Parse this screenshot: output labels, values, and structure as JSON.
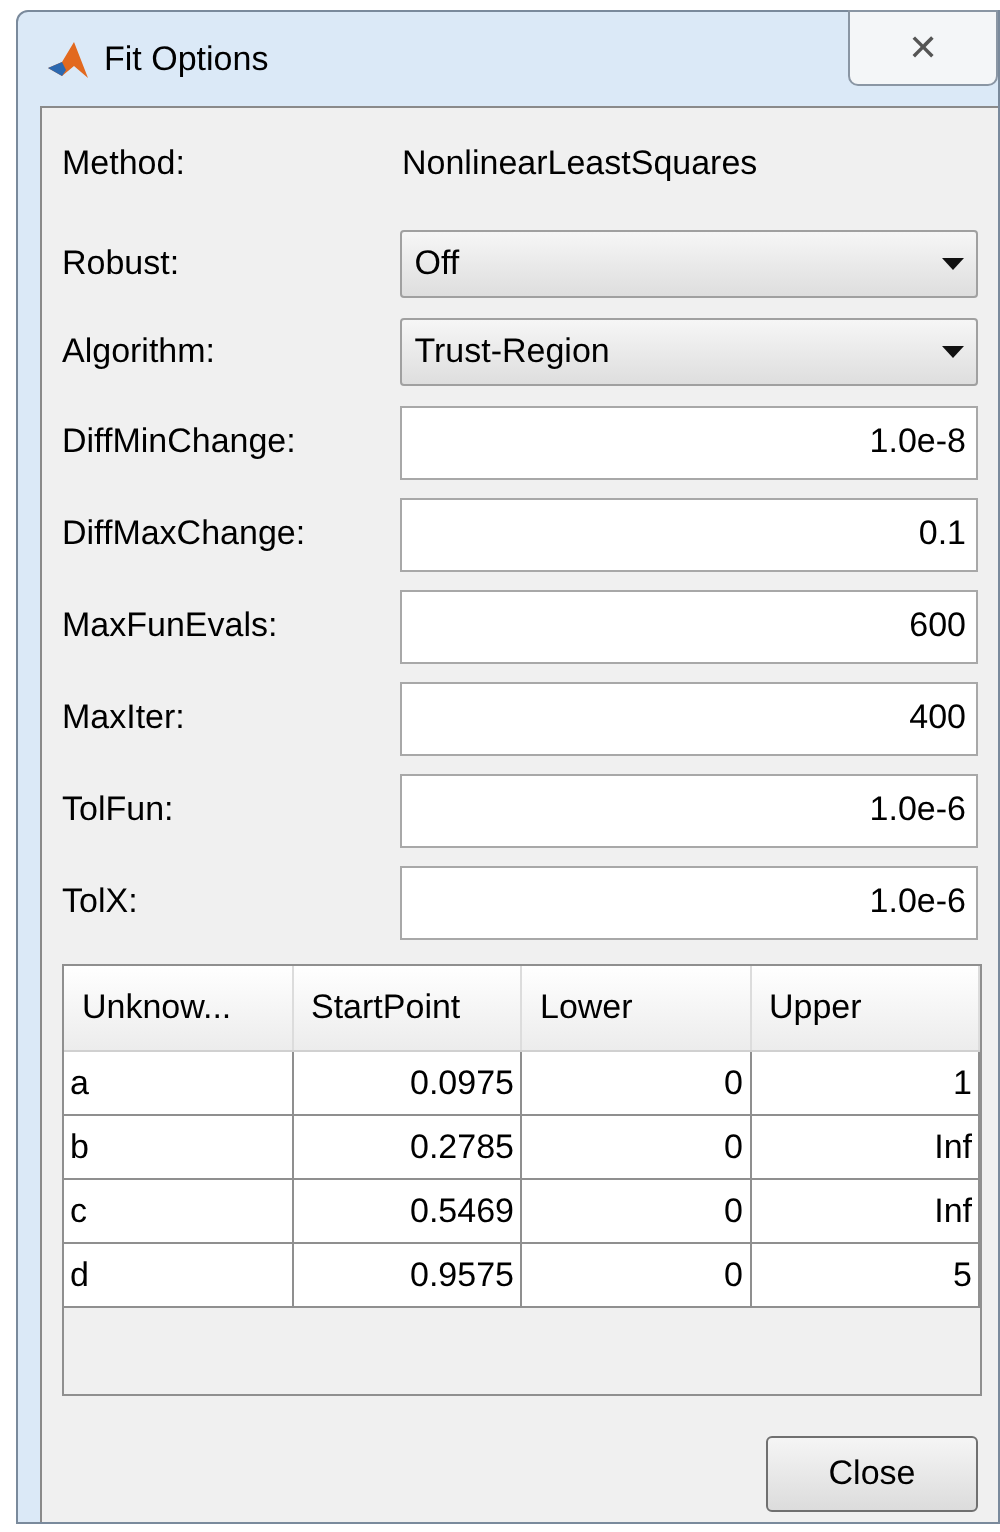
{
  "window": {
    "title": "Fit Options",
    "close": "✕"
  },
  "method": {
    "label": "Method:",
    "value": "NonlinearLeastSquares"
  },
  "options": [
    {
      "kind": "dropdown",
      "label": "Robust:",
      "value": "Off"
    },
    {
      "kind": "dropdown",
      "label": "Algorithm:",
      "value": "Trust-Region"
    },
    {
      "kind": "text",
      "label": "DiffMinChange:",
      "value": "1.0e-8"
    },
    {
      "kind": "text",
      "label": "DiffMaxChange:",
      "value": "0.1"
    },
    {
      "kind": "text",
      "label": "MaxFunEvals:",
      "value": "600"
    },
    {
      "kind": "text",
      "label": "MaxIter:",
      "value": "400"
    },
    {
      "kind": "text",
      "label": "TolFun:",
      "value": "1.0e-6"
    },
    {
      "kind": "text",
      "label": "TolX:",
      "value": "1.0e-6"
    }
  ],
  "table": {
    "columns": [
      "Unknow...",
      "StartPoint",
      "Lower",
      "Upper"
    ],
    "rows": [
      [
        "a",
        "0.0975",
        "0",
        "1"
      ],
      [
        "b",
        "0.2785",
        "0",
        "Inf"
      ],
      [
        "c",
        "0.5469",
        "0",
        "Inf"
      ],
      [
        "d",
        "0.9575",
        "0",
        "5"
      ]
    ]
  },
  "buttons": [
    "Close"
  ]
}
